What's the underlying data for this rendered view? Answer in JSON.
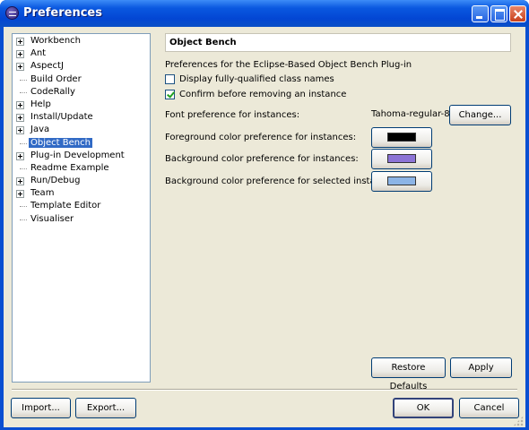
{
  "window": {
    "title": "Preferences",
    "titlebar_color": "#0a58e0",
    "buttons": [
      "minimize-icon",
      "maximize-icon",
      "close-icon"
    ]
  },
  "tree": {
    "items": [
      {
        "label": "Workbench",
        "expandable": true
      },
      {
        "label": "Ant",
        "expandable": true
      },
      {
        "label": "AspectJ",
        "expandable": true
      },
      {
        "label": "Build Order",
        "expandable": false
      },
      {
        "label": "CodeRally",
        "expandable": false
      },
      {
        "label": "Help",
        "expandable": true
      },
      {
        "label": "Install/Update",
        "expandable": true
      },
      {
        "label": "Java",
        "expandable": true
      },
      {
        "label": "Object Bench",
        "expandable": false,
        "selected": true
      },
      {
        "label": "Plug-in Development",
        "expandable": true
      },
      {
        "label": "Readme Example",
        "expandable": false
      },
      {
        "label": "Run/Debug",
        "expandable": true
      },
      {
        "label": "Team",
        "expandable": true
      },
      {
        "label": "Template Editor",
        "expandable": false
      },
      {
        "label": "Visualiser",
        "expandable": false
      }
    ]
  },
  "page": {
    "title": "Object Bench",
    "description": "Preferences for the Eclipse-Based Object Bench Plug-in",
    "checkboxes": [
      {
        "label": "Display fully-qualified class names",
        "checked": false
      },
      {
        "label": "Confirm before removing an instance",
        "checked": true
      }
    ],
    "font_pref": {
      "label": "Font preference for instances:",
      "value": "Tahoma-regular-8",
      "button": "Change..."
    },
    "colors": [
      {
        "label": "Foreground color preference for instances:",
        "color": "#000000"
      },
      {
        "label": "Background color preference for instances:",
        "color": "#8c74d6"
      },
      {
        "label": "Background color preference for selected instances:",
        "color": "#8cb4e6"
      }
    ],
    "restore_defaults": "Restore Defaults",
    "apply": "Apply"
  },
  "footer": {
    "import": "Import...",
    "export": "Export...",
    "ok": "OK",
    "cancel": "Cancel"
  }
}
